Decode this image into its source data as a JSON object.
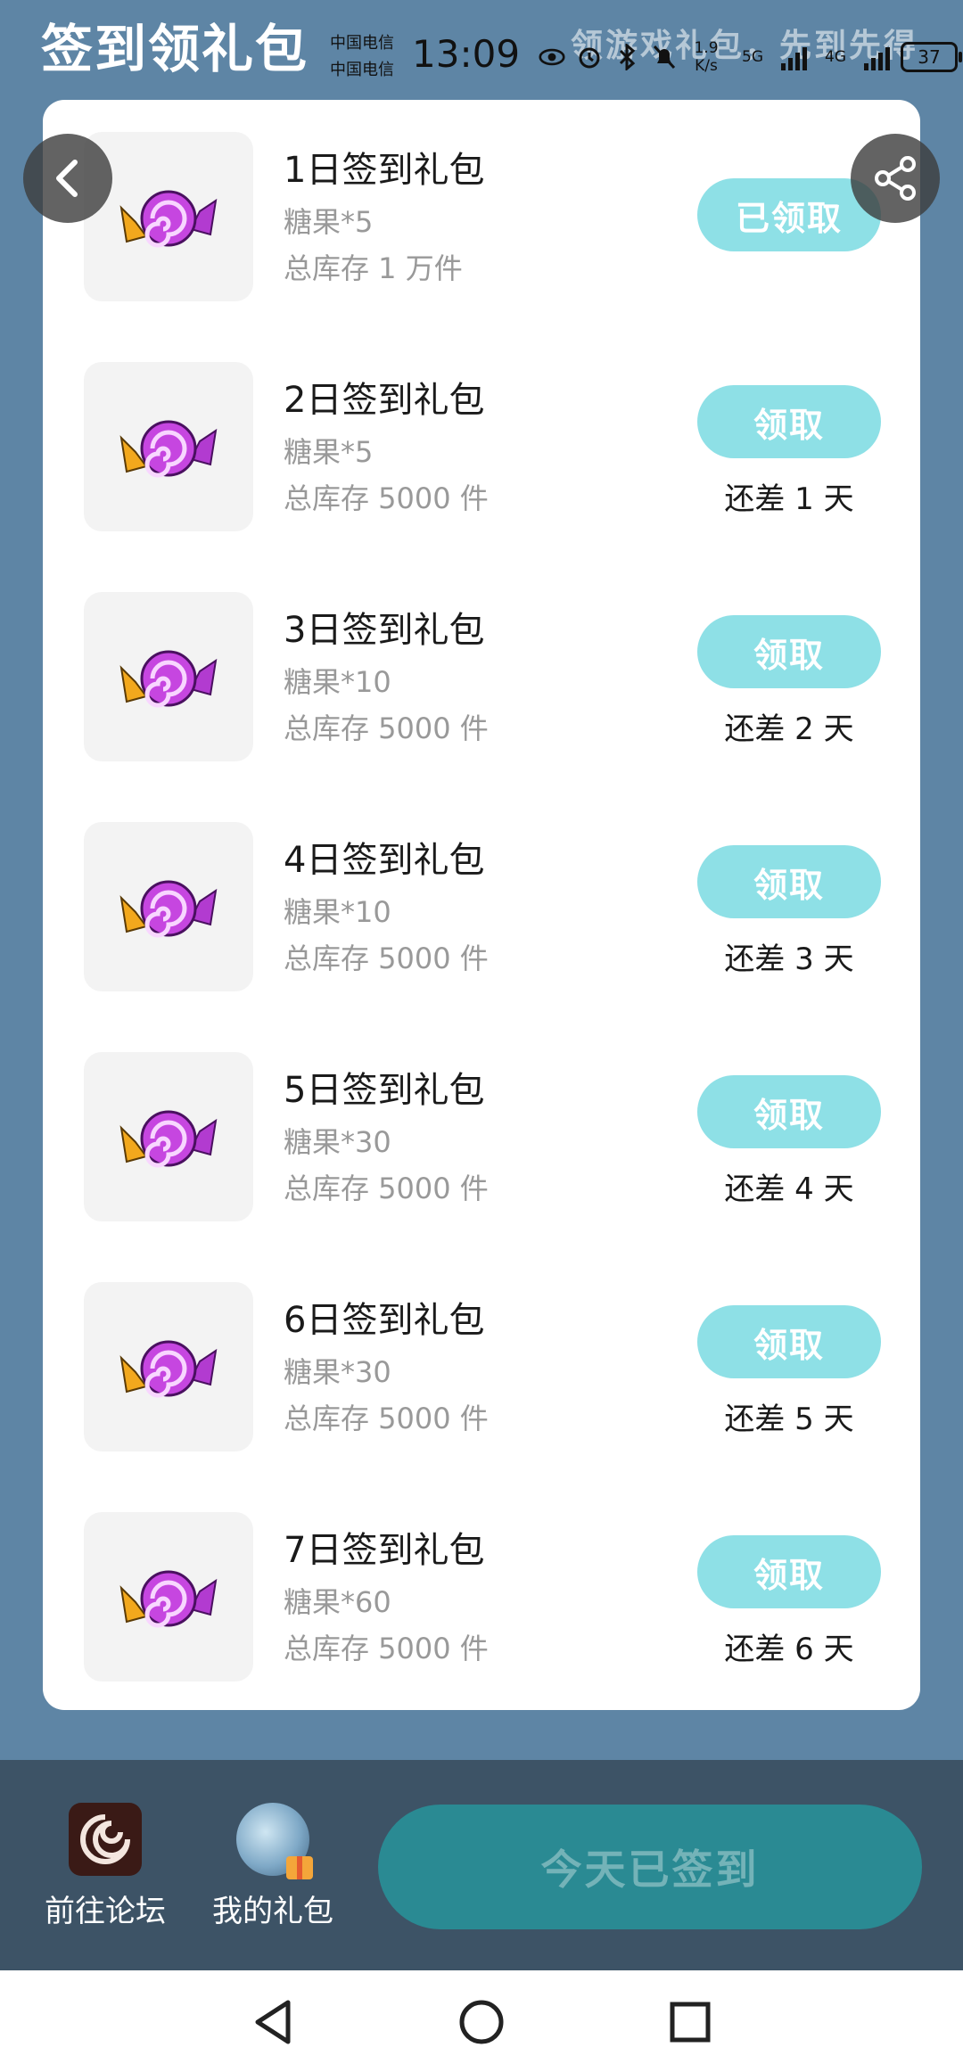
{
  "header": {
    "title": "签到领礼包",
    "slogan": "领游戏礼包，先到先得"
  },
  "status_bar": {
    "carrier_1": "中国电信",
    "carrier_2": "中国电信",
    "time": "13:09",
    "net_speed_value": "1.9",
    "net_speed_unit": "K/s",
    "net_type_1": "5G",
    "net_type_2": "4G",
    "battery": "37"
  },
  "gifts": [
    {
      "title": "1日签到礼包",
      "content": "糖果*5",
      "stock": "总库存 1 万件",
      "button": "已领取",
      "remain": ""
    },
    {
      "title": "2日签到礼包",
      "content": "糖果*5",
      "stock": "总库存 5000 件",
      "button": "领取",
      "remain": "还差 1 天"
    },
    {
      "title": "3日签到礼包",
      "content": "糖果*10",
      "stock": "总库存 5000 件",
      "button": "领取",
      "remain": "还差 2 天"
    },
    {
      "title": "4日签到礼包",
      "content": "糖果*10",
      "stock": "总库存 5000 件",
      "button": "领取",
      "remain": "还差 3 天"
    },
    {
      "title": "5日签到礼包",
      "content": "糖果*30",
      "stock": "总库存 5000 件",
      "button": "领取",
      "remain": "还差 4 天"
    },
    {
      "title": "6日签到礼包",
      "content": "糖果*30",
      "stock": "总库存 5000 件",
      "button": "领取",
      "remain": "还差 5 天"
    },
    {
      "title": "7日签到礼包",
      "content": "糖果*60",
      "stock": "总库存 5000 件",
      "button": "领取",
      "remain": "还差 6 天"
    }
  ],
  "bottom_bar": {
    "forum_label": "前往论坛",
    "my_gifts_label": "我的礼包",
    "signin_button": "今天已签到"
  },
  "colors": {
    "background": "#5e85a5",
    "claim_button": "#8ee0e6",
    "signin_button": "#2a8a93",
    "bottom_bar": "#3d5366"
  },
  "icons": {
    "back": "back-arrow-icon",
    "share": "share-icon",
    "gift_item": "candy-icon",
    "nav_back": "triangle-back-icon",
    "nav_home": "circle-home-icon",
    "nav_recent": "square-recent-icon"
  }
}
